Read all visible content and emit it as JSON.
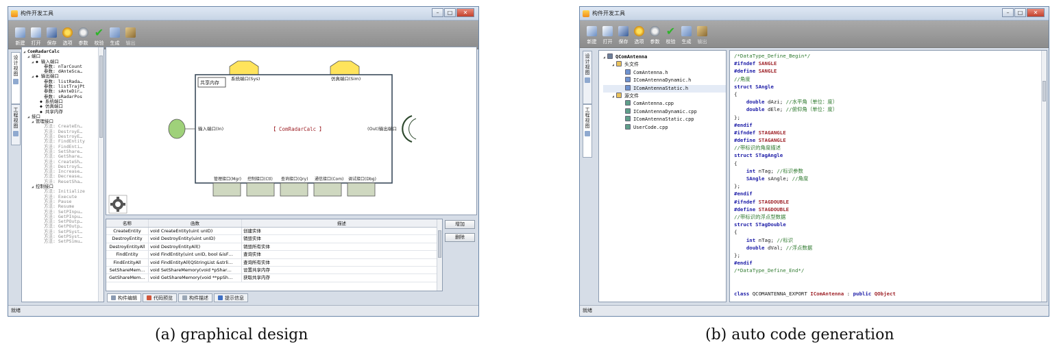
{
  "left": {
    "title": "构件开发工具",
    "toolbar": [
      {
        "label": "新建",
        "icon": "new-icon"
      },
      {
        "label": "打开",
        "icon": "open-icon"
      },
      {
        "label": "保存",
        "icon": "save-icon"
      },
      {
        "label": "选项",
        "icon": "options-icon"
      },
      {
        "label": "参数",
        "icon": "params-icon"
      },
      {
        "label": "校验",
        "icon": "check-icon"
      },
      {
        "label": "生成",
        "icon": "generate-icon"
      },
      {
        "label": "输出",
        "icon": "output-icon"
      }
    ],
    "side_tabs": [
      "设计视图",
      "工程视图"
    ],
    "tree": [
      {
        "t": "ComRadarCalc",
        "lvl": 0,
        "tri": "◢",
        "gray": false
      },
      {
        "t": "端口",
        "lvl": 1,
        "tri": "◢",
        "gray": false
      },
      {
        "t": "◆ 输入端口",
        "lvl": 2,
        "tri": "◢",
        "gray": false
      },
      {
        "t": "参数: nTarCount",
        "lvl": 4,
        "tri": "",
        "gray": false
      },
      {
        "t": "参数: dAnteSca…",
        "lvl": 4,
        "tri": "",
        "gray": false
      },
      {
        "t": "◆ 输出端口",
        "lvl": 2,
        "tri": "◢",
        "gray": false
      },
      {
        "t": "参数: listRada…",
        "lvl": 4,
        "tri": "",
        "gray": false
      },
      {
        "t": "参数: listTrajPt",
        "lvl": 4,
        "tri": "",
        "gray": false
      },
      {
        "t": "参数: sAnteDir…",
        "lvl": 4,
        "tri": "",
        "gray": false
      },
      {
        "t": "参数: sRadarPos",
        "lvl": 4,
        "tri": "",
        "gray": false
      },
      {
        "t": "◆ 系统端口",
        "lvl": 3,
        "tri": "",
        "gray": false
      },
      {
        "t": "◆ 仿真端口",
        "lvl": 3,
        "tri": "",
        "gray": false
      },
      {
        "t": "◆ 共享内存",
        "lvl": 3,
        "tri": "",
        "gray": false
      },
      {
        "t": "接口",
        "lvl": 1,
        "tri": "◢",
        "gray": false
      },
      {
        "t": "管理接口",
        "lvl": 2,
        "tri": "◢",
        "gray": false
      },
      {
        "t": "方法: CreateEn…",
        "lvl": 4,
        "tri": "",
        "gray": true
      },
      {
        "t": "方法: DestroyE…",
        "lvl": 4,
        "tri": "",
        "gray": true
      },
      {
        "t": "方法: DestroyE…",
        "lvl": 4,
        "tri": "",
        "gray": true
      },
      {
        "t": "方法: FindEntity",
        "lvl": 4,
        "tri": "",
        "gray": true
      },
      {
        "t": "方法: FindEnti…",
        "lvl": 4,
        "tri": "",
        "gray": true
      },
      {
        "t": "方法: SetShare…",
        "lvl": 4,
        "tri": "",
        "gray": true
      },
      {
        "t": "方法: GetShare…",
        "lvl": 4,
        "tri": "",
        "gray": true
      },
      {
        "t": "方法: CreateSh…",
        "lvl": 4,
        "tri": "",
        "gray": true
      },
      {
        "t": "方法: DestroyS…",
        "lvl": 4,
        "tri": "",
        "gray": true
      },
      {
        "t": "方法: Increase…",
        "lvl": 4,
        "tri": "",
        "gray": true
      },
      {
        "t": "方法: Decrease…",
        "lvl": 4,
        "tri": "",
        "gray": true
      },
      {
        "t": "方法: ResetSha…",
        "lvl": 4,
        "tri": "",
        "gray": true
      },
      {
        "t": "控制接口",
        "lvl": 2,
        "tri": "◢",
        "gray": false
      },
      {
        "t": "方法: Initialize",
        "lvl": 4,
        "tri": "",
        "gray": true
      },
      {
        "t": "方法: Execute",
        "lvl": 4,
        "tri": "",
        "gray": true
      },
      {
        "t": "方法: Pause",
        "lvl": 4,
        "tri": "",
        "gray": true
      },
      {
        "t": "方法: Resume",
        "lvl": 4,
        "tri": "",
        "gray": true
      },
      {
        "t": "方法: SetPInpu…",
        "lvl": 4,
        "tri": "",
        "gray": true
      },
      {
        "t": "方法: GetPInpu…",
        "lvl": 4,
        "tri": "",
        "gray": true
      },
      {
        "t": "方法: SetPOutp…",
        "lvl": 4,
        "tri": "",
        "gray": true
      },
      {
        "t": "方法: GetPOutp…",
        "lvl": 4,
        "tri": "",
        "gray": true
      },
      {
        "t": "方法: SetPSyst…",
        "lvl": 4,
        "tri": "",
        "gray": true
      },
      {
        "t": "方法: GetPSyst…",
        "lvl": 4,
        "tri": "",
        "gray": true
      },
      {
        "t": "方法: SetPSimu…",
        "lvl": 4,
        "tri": "",
        "gray": true
      }
    ],
    "diagram": {
      "component": "【 ComRadarCalc 】",
      "shared_memory": "共享内存",
      "sys_port": "系统端口(Sys)",
      "sim_port": "仿真端口(Sim)",
      "in_port": "输入端口(In)",
      "out_port": "(Out)输出端口",
      "bottom_ports": [
        "管理接口(Mgr)",
        "控制接口(Ctl)",
        "查询接口(Qry)",
        "通信接口(Com)",
        "调试接口(Dbg)"
      ]
    },
    "table": {
      "headers": [
        "名称",
        "函数",
        "描述"
      ],
      "rows": [
        [
          "CreateEntity",
          "void CreateEntity(uint unID)",
          "创建实体"
        ],
        [
          "DestroyEntity",
          "void DestroyEntity(uint unID)",
          "销毁实体"
        ],
        [
          "DestroyEntityAll",
          "void DestroyEntityAll()",
          "销毁所有实体"
        ],
        [
          "FindEntity",
          "void FindEntity(uint unID, bool &isF…",
          "查询实体"
        ],
        [
          "FindEntityAll",
          "void FindEntityAll(QStringList &strli…",
          "查询所有实体"
        ],
        [
          "SetShareMem…",
          "void SetShareMemory(void *pShar…",
          "设置共享内存"
        ],
        [
          "GetShareMem…",
          "void GetShareMemory(void **ppSh…",
          "获取共享内存"
        ]
      ]
    },
    "add_label": "增加",
    "delete_label": "删除",
    "bottom_tabs": [
      "构件编辑",
      "代码预览",
      "构件描述",
      "提示信息"
    ],
    "status": "就绪"
  },
  "right": {
    "title": "构件开发工具",
    "toolbar": [
      {
        "label": "新建",
        "icon": "new-icon"
      },
      {
        "label": "打开",
        "icon": "open-icon"
      },
      {
        "label": "保存",
        "icon": "save-icon"
      },
      {
        "label": "选项",
        "icon": "options-icon"
      },
      {
        "label": "参数",
        "icon": "params-icon"
      },
      {
        "label": "校验",
        "icon": "check-icon"
      },
      {
        "label": "生成",
        "icon": "generate-icon"
      },
      {
        "label": "输出",
        "icon": "output-icon"
      }
    ],
    "side_tabs": [
      "设计视图",
      "工程视图"
    ],
    "tree": [
      {
        "t": "QComAntenna",
        "lvl": 0,
        "tri": "◢",
        "kind": "root"
      },
      {
        "t": "头文件",
        "lvl": 1,
        "tri": "◢",
        "kind": "folder"
      },
      {
        "t": "ComAntenna.h",
        "lvl": 2,
        "tri": "",
        "kind": "h"
      },
      {
        "t": "IComAntennaDynamic.h",
        "lvl": 2,
        "tri": "",
        "kind": "h"
      },
      {
        "t": "IComAntennaStatic.h",
        "lvl": 2,
        "tri": "",
        "kind": "h"
      },
      {
        "t": "源文件",
        "lvl": 1,
        "tri": "◢",
        "kind": "folder"
      },
      {
        "t": "ComAntenna.cpp",
        "lvl": 2,
        "tri": "",
        "kind": "cpp"
      },
      {
        "t": "IComAntennaDynamic.cpp",
        "lvl": 2,
        "tri": "",
        "kind": "cpp"
      },
      {
        "t": "IComAntennaStatic.cpp",
        "lvl": 2,
        "tri": "",
        "kind": "cpp"
      },
      {
        "t": "UserCode.cpp",
        "lvl": 2,
        "tri": "",
        "kind": "cpp"
      }
    ],
    "code": [
      [
        [
          "c",
          "/*DataType_Define_Begin*/"
        ]
      ],
      [
        [
          "k",
          "#ifndef "
        ],
        [
          "m",
          "SANGLE"
        ]
      ],
      [
        [
          "k",
          "#define "
        ],
        [
          "m",
          "SANGLE"
        ]
      ],
      [
        [
          "c",
          "//角度"
        ]
      ],
      [
        [
          "k",
          "struct "
        ],
        [
          "k",
          "SAngle"
        ]
      ],
      [
        [
          "p",
          "{"
        ]
      ],
      [
        [
          "p",
          "    "
        ],
        [
          "k",
          "double "
        ],
        [
          "p",
          "dAzi; "
        ],
        [
          "c",
          "//水平角（单位：度）"
        ]
      ],
      [
        [
          "p",
          "    "
        ],
        [
          "k",
          "double "
        ],
        [
          "p",
          "dEle; "
        ],
        [
          "c",
          "//俯仰角（单位：度）"
        ]
      ],
      [
        [
          "p",
          "};"
        ]
      ],
      [
        [
          "k",
          "#endif"
        ]
      ],
      [
        [
          "k",
          "#ifndef "
        ],
        [
          "m",
          "STAGANGLE"
        ]
      ],
      [
        [
          "k",
          "#define "
        ],
        [
          "m",
          "STAGANGLE"
        ]
      ],
      [
        [
          "c",
          "//带标识的角度描述"
        ]
      ],
      [
        [
          "k",
          "struct "
        ],
        [
          "k",
          "STagAngle"
        ]
      ],
      [
        [
          "p",
          "{"
        ]
      ],
      [
        [
          "p",
          "    "
        ],
        [
          "k",
          "int "
        ],
        [
          "p",
          "nTag; "
        ],
        [
          "c",
          "//标识参数"
        ]
      ],
      [
        [
          "p",
          "    "
        ],
        [
          "k",
          "SAngle "
        ],
        [
          "p",
          "sAngle; "
        ],
        [
          "c",
          "//角度"
        ]
      ],
      [
        [
          "p",
          "};"
        ]
      ],
      [
        [
          "k",
          "#endif"
        ]
      ],
      [
        [
          "k",
          "#ifndef "
        ],
        [
          "m",
          "STAGDOUBLE"
        ]
      ],
      [
        [
          "k",
          "#define "
        ],
        [
          "m",
          "STAGDOUBLE"
        ]
      ],
      [
        [
          "c",
          "//带标识的浮点型数据"
        ]
      ],
      [
        [
          "k",
          "struct "
        ],
        [
          "k",
          "STagDouble"
        ]
      ],
      [
        [
          "p",
          "{"
        ]
      ],
      [
        [
          "p",
          "    "
        ],
        [
          "k",
          "int "
        ],
        [
          "p",
          "nTag; "
        ],
        [
          "c",
          "//标识"
        ]
      ],
      [
        [
          "p",
          "    "
        ],
        [
          "k",
          "double "
        ],
        [
          "p",
          "dVal; "
        ],
        [
          "c",
          "//浮点数据"
        ]
      ],
      [
        [
          "p",
          "};"
        ]
      ],
      [
        [
          "k",
          "#endif"
        ]
      ],
      [
        [
          "c",
          "/*DataType_Define_End*/"
        ]
      ],
      [
        [
          "p",
          ""
        ]
      ],
      [
        [
          "p",
          ""
        ]
      ],
      [
        [
          "k",
          "class "
        ],
        [
          "p",
          "QCOMANTENNA_EXPORT "
        ],
        [
          "m",
          "IComAntenna"
        ],
        [
          "p",
          " : "
        ],
        [
          "k",
          "public "
        ],
        [
          "m",
          "QObject"
        ]
      ]
    ],
    "status": "就绪"
  },
  "captions": {
    "a": "(a) graphical design",
    "b": "(b) auto code generation"
  },
  "colors": {
    "keyword": "#1a1aa6",
    "macro": "#a0262c",
    "comment": "#2f7a2f",
    "plain": "#1a1a1a",
    "port_yellow": "#ffe45c",
    "port_green": "#9fd17a",
    "interface_box": "#cfd8c0"
  }
}
